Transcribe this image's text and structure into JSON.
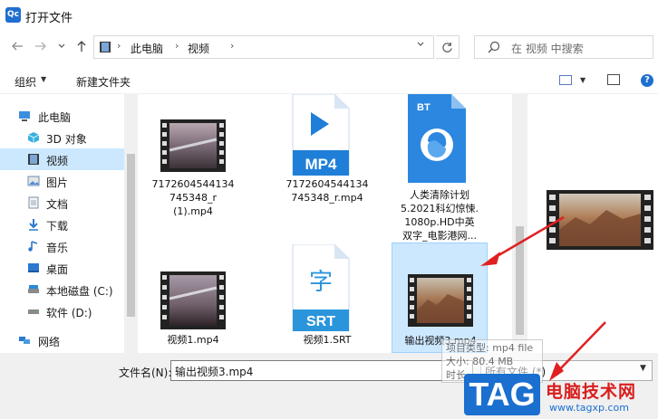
{
  "window": {
    "title": "打开文件",
    "app_icon": "Qc"
  },
  "nav": {
    "back_icon": "arrow-left-icon",
    "forward_icon": "arrow-right-icon",
    "recent_icon": "chevron-down-icon",
    "up_icon": "arrow-up-icon",
    "breadcrumb": [
      "此电脑",
      "视频"
    ],
    "refresh_icon": "refresh-icon",
    "search_placeholder": "在 视频 中搜索"
  },
  "toolbar": {
    "organize": "组织",
    "new_folder": "新建文件夹"
  },
  "sidebar": {
    "items": [
      {
        "label": "此电脑",
        "icon": "computer-icon"
      },
      {
        "label": "3D 对象",
        "icon": "cube-icon"
      },
      {
        "label": "视频",
        "icon": "video-icon"
      },
      {
        "label": "图片",
        "icon": "picture-icon"
      },
      {
        "label": "文档",
        "icon": "document-icon"
      },
      {
        "label": "下载",
        "icon": "download-icon"
      },
      {
        "label": "音乐",
        "icon": "music-icon"
      },
      {
        "label": "桌面",
        "icon": "desktop-icon"
      },
      {
        "label": "本地磁盘 (C:)",
        "icon": "disk-icon"
      },
      {
        "label": "软件 (D:)",
        "icon": "disk-icon"
      },
      {
        "label": "网络",
        "icon": "network-icon"
      }
    ],
    "selected": "视频"
  },
  "files": [
    {
      "name": "7172604544134745348_r(1).mp4",
      "lines": [
        "7172604544134",
        "745348_r",
        "(1).mp4"
      ],
      "kind": "video-thumb"
    },
    {
      "name": "7172604544134745348_r.mp4",
      "lines": [
        "7172604544134",
        "745348_r.mp4"
      ],
      "kind": "mp4-icon",
      "badge": "MP4"
    },
    {
      "name": "人类清除计划5.2021科幻惊悚.1080p.HD中英双字_电影港网...",
      "lines": [
        "人类清除计划",
        "5.2021科幻惊悚.",
        "1080p.HD中英",
        "双字_电影港网..."
      ],
      "kind": "bt-icon",
      "badge": "BT"
    },
    {
      "name": "视频1.mp4",
      "lines": [
        "视频1.mp4"
      ],
      "kind": "video-thumb"
    },
    {
      "name": "视频1.SRT",
      "lines": [
        "视频1.SRT"
      ],
      "kind": "srt-icon",
      "badge": "SRT",
      "glyph": "字"
    },
    {
      "name": "输出视频3.mp4",
      "lines": [
        "输出视频3.mp4"
      ],
      "kind": "video-thumb-selected"
    }
  ],
  "tooltip": {
    "type": "项目类型: mp4 file",
    "size": "大小: 80.4 MB",
    "date": "时长"
  },
  "bottom": {
    "filename_label": "文件名(N):",
    "filename_value": "输出视频3.mp4",
    "filetype_value": "所有文件 (*)"
  },
  "watermark": {
    "tag": "TAG",
    "title": "电脑技术网",
    "url": "www.tagxp.com"
  },
  "colors": {
    "accent": "#1e6fd0",
    "selection": "#cce8ff",
    "arrow": "#e02020"
  }
}
